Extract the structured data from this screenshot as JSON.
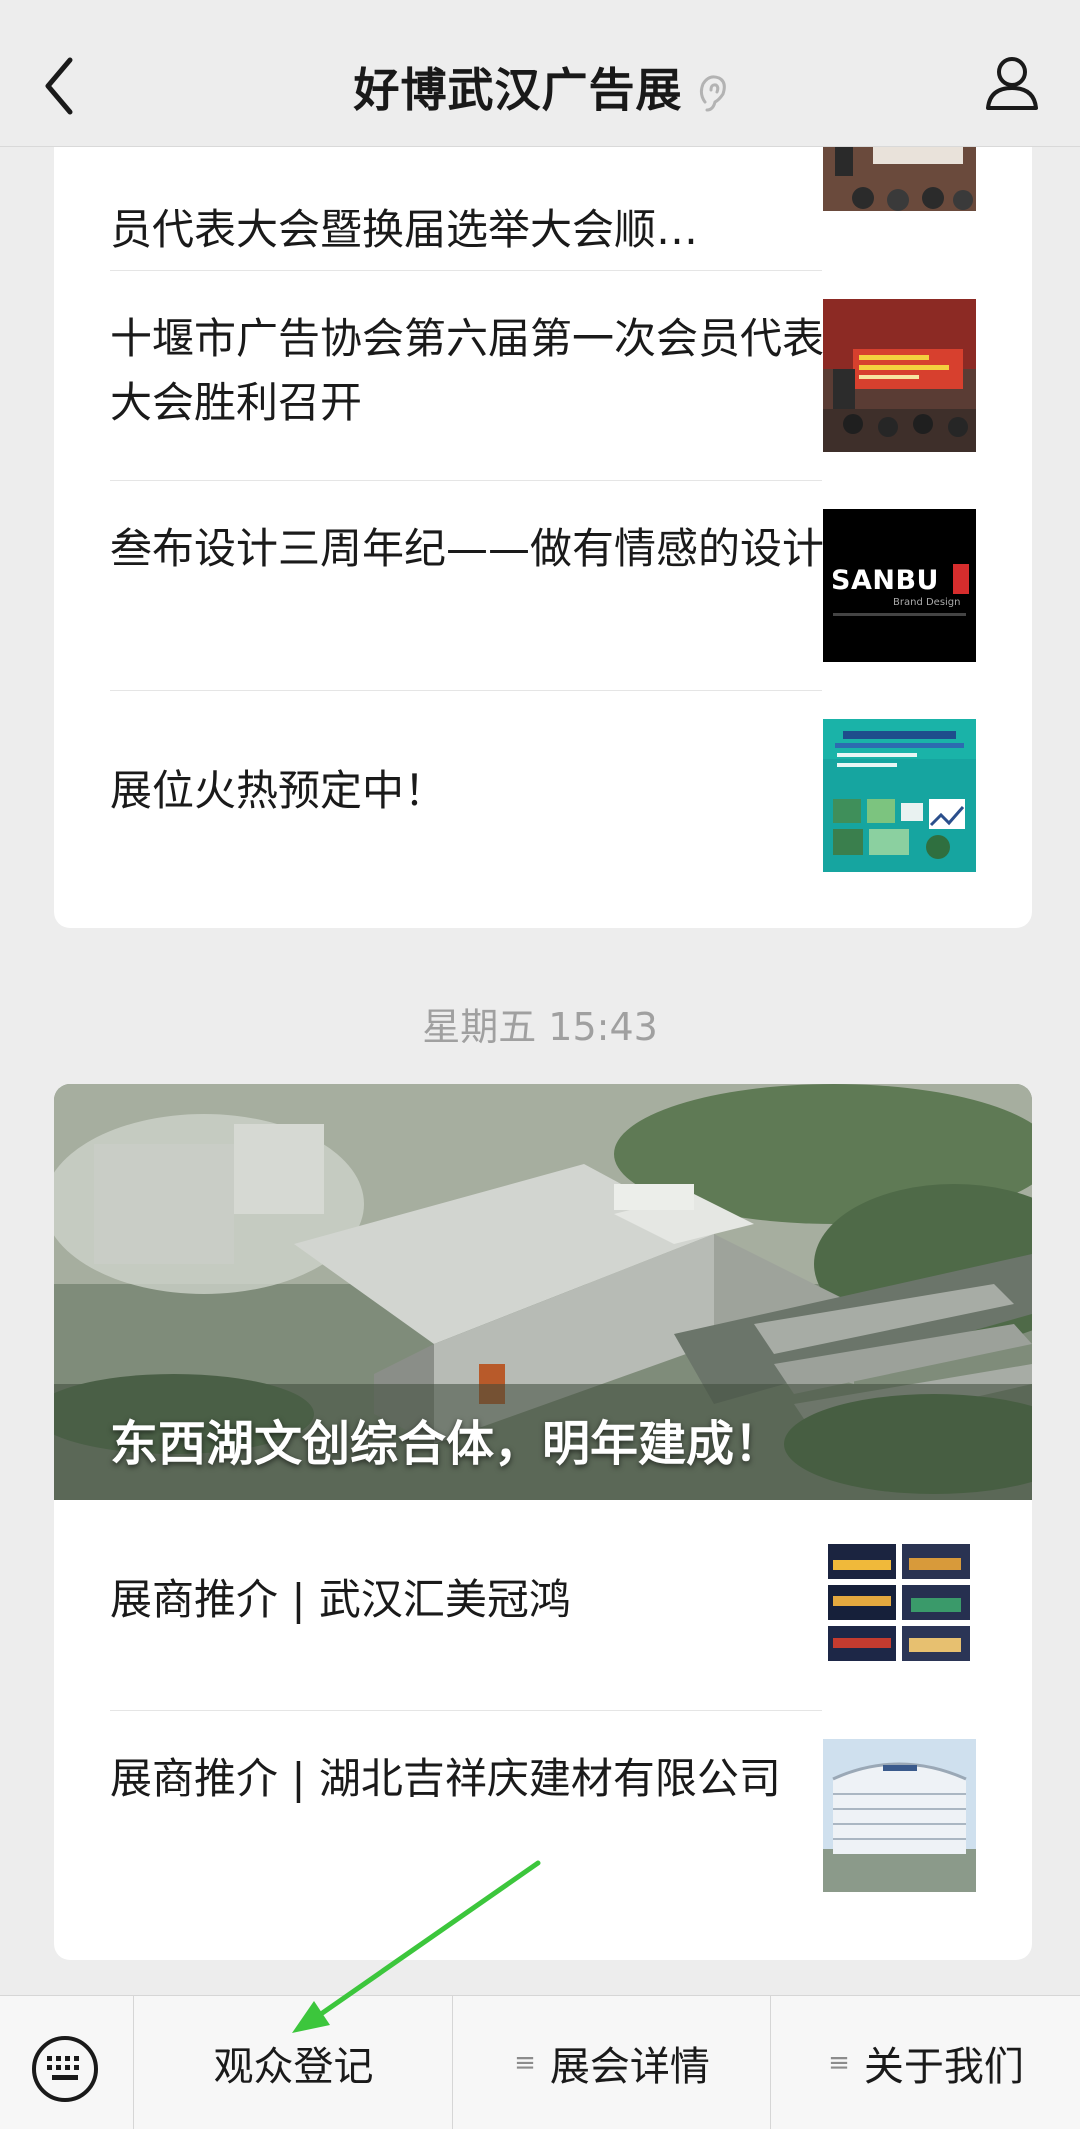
{
  "header": {
    "title": "好博武汉广告展",
    "back_icon": "back-arrow-icon",
    "ear_icon": "ear-icon",
    "user_icon": "user-icon"
  },
  "feed": {
    "card1": {
      "items": [
        {
          "title": "员代表大会暨换届选举大会顺…"
        },
        {
          "title": "十堰市广告协会第六届第一次会员代表大会胜利召开"
        },
        {
          "title": "叁布设计三周年纪——做有情感的设计",
          "thumb_text": "SANBU",
          "thumb_sub": "Brand Design"
        },
        {
          "title": "展位火热预定中！"
        }
      ]
    },
    "timestamp": "星期五 15:43",
    "card2": {
      "hero_title": "东西湖文创综合体，明年建成！",
      "items": [
        {
          "title": "展商推介 | 武汉汇美冠鸿"
        },
        {
          "title": "展商推介 | 湖北吉祥庆建材有限公司"
        }
      ]
    }
  },
  "menu": {
    "keyboard_icon": "keyboard-icon",
    "items": [
      {
        "label": "观众登记"
      },
      {
        "label": "展会详情",
        "icon": "submenu-icon"
      },
      {
        "label": "关于我们",
        "icon": "submenu-icon"
      }
    ]
  },
  "colors": {
    "background": "#ededed",
    "card": "#ffffff",
    "annotation_arrow": "#3cc63c"
  }
}
